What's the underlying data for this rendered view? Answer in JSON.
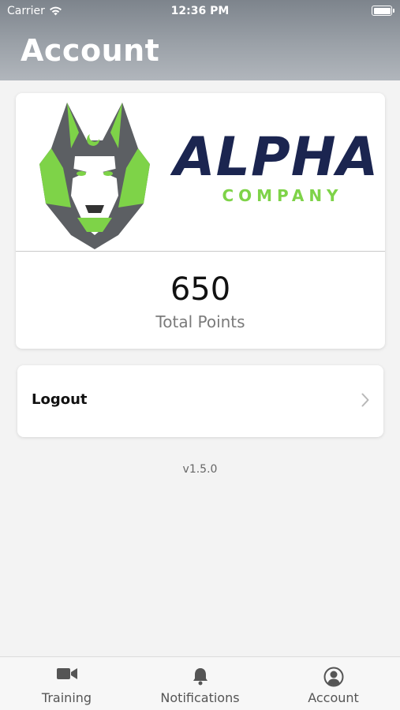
{
  "status_bar": {
    "carrier": "Carrier",
    "time": "12:36 PM"
  },
  "header": {
    "title": "Account"
  },
  "logo": {
    "primary_text": "ALPHA",
    "secondary_text": "COMPANY",
    "brand_navy": "#1b2550",
    "brand_green": "#7ed348"
  },
  "points": {
    "value": "650",
    "label": "Total Points"
  },
  "menu": {
    "logout_label": "Logout"
  },
  "app": {
    "version": "v1.5.0"
  },
  "tabs": [
    {
      "label": "Training",
      "icon": "video-camera-icon"
    },
    {
      "label": "Notifications",
      "icon": "bell-icon"
    },
    {
      "label": "Account",
      "icon": "user-circle-icon"
    }
  ]
}
